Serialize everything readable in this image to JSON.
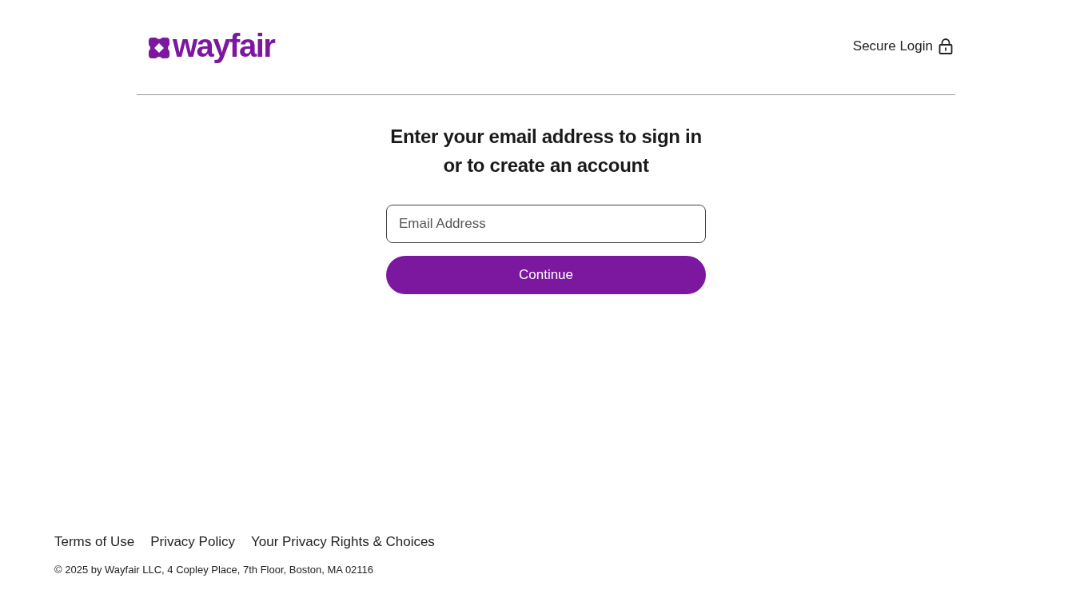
{
  "header": {
    "logo": {
      "wordmark": "wayfair"
    },
    "secure_label": "Secure Login"
  },
  "form": {
    "heading_lines": [
      "Enter your email address to sign in",
      "or to create an account"
    ],
    "email_field": {
      "placeholder": "Email Address"
    },
    "submit": "Continue"
  },
  "footer": {
    "links": [
      "Terms of Use",
      "Privacy Policy",
      "Your Privacy Rights & Choices"
    ],
    "copyright": "© 2025 by Wayfair LLC, 4 Copley Place, 7th Floor, Boston, MA 02116"
  }
}
